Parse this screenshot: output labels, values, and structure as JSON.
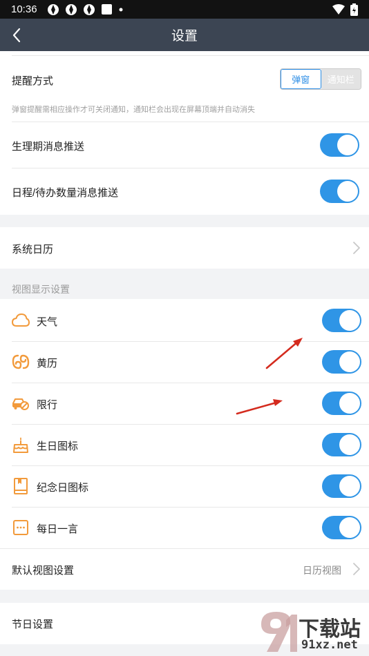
{
  "status_bar": {
    "time": "10:36"
  },
  "nav": {
    "title": "设置"
  },
  "reminder": {
    "label": "提醒方式",
    "option_popup": "弹窗",
    "option_notify": "通知栏",
    "hint": "弹窗提醒需相应操作才可关闭通知，通知栏会出现在屏幕顶端并自动消失"
  },
  "period_push": {
    "label": "生理期消息推送",
    "enabled": true
  },
  "schedule_push": {
    "label": "日程/待办数量消息推送",
    "enabled": true
  },
  "system_calendar": {
    "label": "系统日历"
  },
  "view_settings": {
    "title": "视图显示设置",
    "items": [
      {
        "label": "天气",
        "icon": "cloud-icon",
        "enabled": true
      },
      {
        "label": "黄历",
        "icon": "almanac-icon",
        "enabled": true
      },
      {
        "label": "限行",
        "icon": "car-restriction-icon",
        "enabled": true
      },
      {
        "label": "生日图标",
        "icon": "cake-icon",
        "enabled": true
      },
      {
        "label": "纪念日图标",
        "icon": "book-icon",
        "enabled": true
      },
      {
        "label": "每日一言",
        "icon": "quote-icon",
        "enabled": true
      }
    ],
    "default_view": {
      "label": "默认视图设置",
      "value": "日历视图"
    }
  },
  "holiday_settings": {
    "label": "节日设置"
  },
  "watermark": {
    "text1": "下载站",
    "text2": "91xz.net"
  },
  "colors": {
    "accent": "#2f95e6",
    "nav": "#3c4553",
    "icon_orange": "#f29a3b"
  }
}
